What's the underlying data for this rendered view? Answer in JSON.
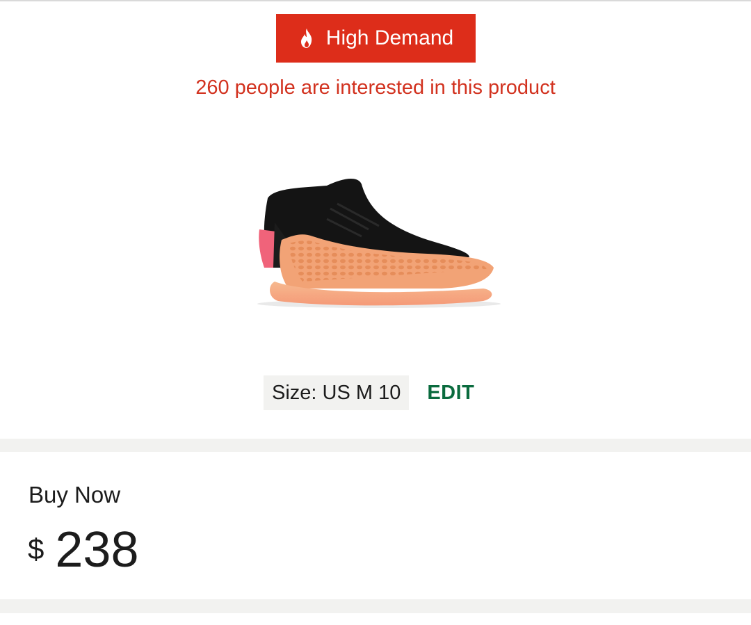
{
  "demand_badge": {
    "icon": "flame-icon",
    "label": "High Demand",
    "color": "#dd2d1a"
  },
  "interest_text": "260 people are interested in this product",
  "product_image": {
    "description_icon": "sneaker-image"
  },
  "size": {
    "label": "Size: US M 10",
    "edit_label": "EDIT",
    "edit_color": "#0a6b3e"
  },
  "buy_now": {
    "title": "Buy Now",
    "currency": "$",
    "amount": "238"
  }
}
